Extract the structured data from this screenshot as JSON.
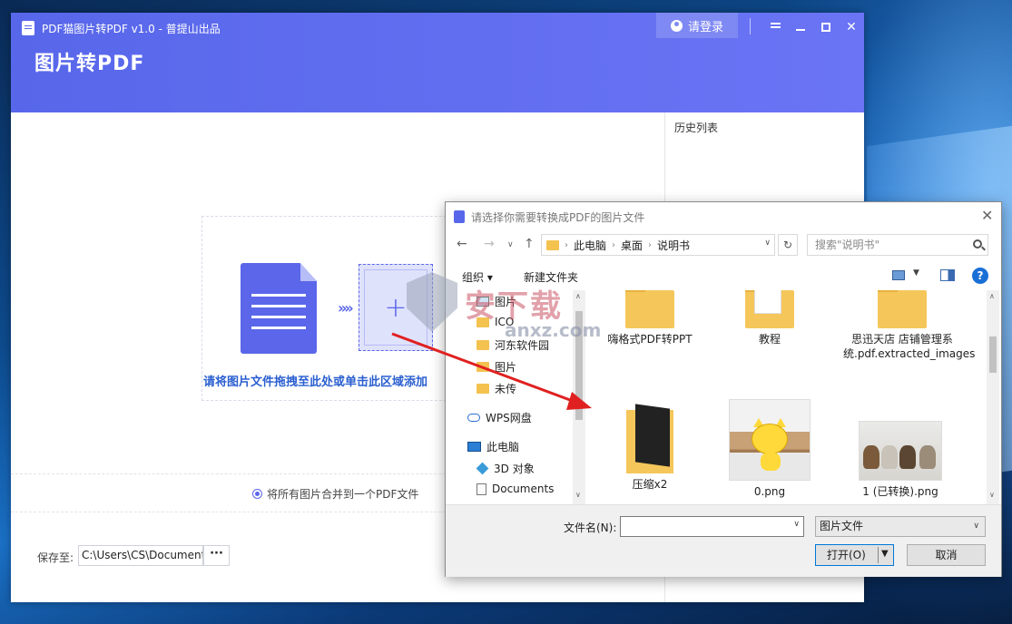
{
  "app": {
    "window_title": "PDF猫图片转PDF v1.0 - 普提山出品",
    "big_title": "图片转PDF",
    "login_label": "请登录",
    "drop_hint": "请将图片文件拖拽至此处或单击此区域添加",
    "merge_option": "将所有图片合并到一个PDF文件",
    "save_label": "保存至:",
    "save_path": "C:\\Users\\CS\\Documents",
    "save_more": "···",
    "history_title": "历史列表",
    "add_symbol": "+",
    "arrows_symbol": "»»"
  },
  "dialog": {
    "title": "请选择你需要转换成PDF的图片文件",
    "address": [
      "此电脑",
      "桌面",
      "说明书"
    ],
    "search_placeholder": "搜索\"说明书\"",
    "toolbar": {
      "organize": "组织 ▾",
      "new_folder": "新建文件夹",
      "help": "?"
    },
    "nav_items": [
      {
        "label": "图片",
        "icon": "image-icon"
      },
      {
        "label": "ICO",
        "icon": "folder-icon"
      },
      {
        "label": "河东软件园",
        "icon": "folder-icon"
      },
      {
        "label": "图片",
        "icon": "folder-icon"
      },
      {
        "label": "未传",
        "icon": "folder-icon"
      },
      {
        "label": "WPS网盘",
        "icon": "cloud-icon"
      },
      {
        "label": "此电脑",
        "icon": "computer-icon"
      },
      {
        "label": "3D 对象",
        "icon": "cube-icon"
      },
      {
        "label": "Documents",
        "icon": "document-icon"
      }
    ],
    "files": [
      {
        "label": "嗨格式PDF转PPT",
        "kind": "folder"
      },
      {
        "label": "教程",
        "kind": "folder"
      },
      {
        "label": "思迅天店 店铺管理系统.pdf.extracted_images",
        "kind": "folder"
      },
      {
        "label": "压缩x2",
        "kind": "folder-images"
      },
      {
        "label": "0.png",
        "kind": "image"
      },
      {
        "label": "1 (已转换).png",
        "kind": "image"
      }
    ],
    "filename_label": "文件名(N):",
    "filename_value": "",
    "filetype": "图片文件",
    "open_label": "打开(O)",
    "cancel_label": "取消"
  },
  "watermark": {
    "text": "安下载",
    "sub": "anxz.com"
  },
  "colors": {
    "brand": "#5867ea",
    "accent_text": "#2a5fd0",
    "annotation_arrow": "#e02020",
    "folder": "#f5c65a"
  }
}
